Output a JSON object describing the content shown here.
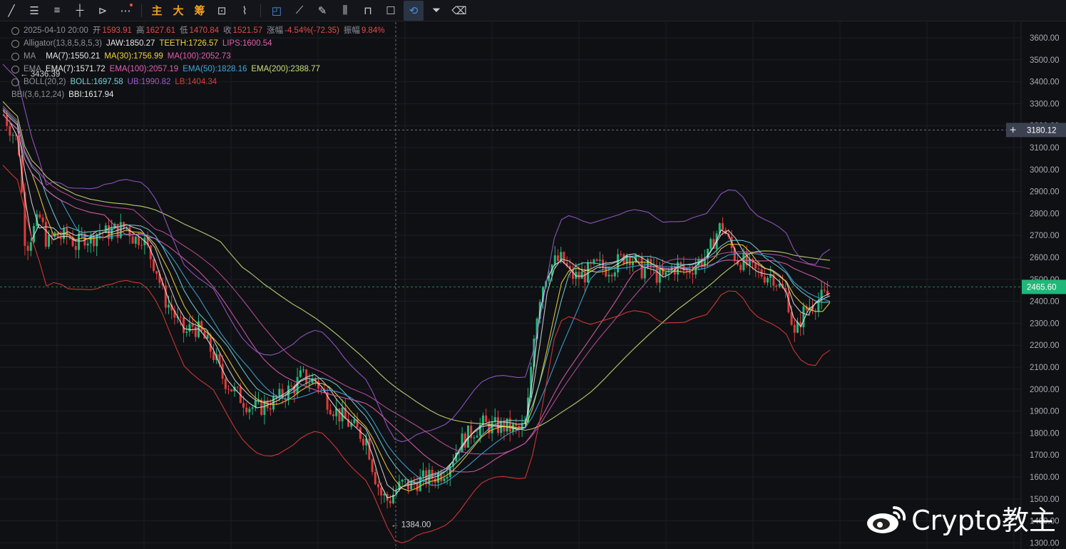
{
  "toolbar": {
    "tools": [
      {
        "name": "line-tool-icon",
        "glyph": "╱"
      },
      {
        "name": "parallel-lines-icon",
        "glyph": "☰"
      },
      {
        "name": "channel-icon",
        "glyph": "≡"
      },
      {
        "name": "horizontal-line-icon",
        "glyph": "┼"
      },
      {
        "name": "arrow-tool-icon",
        "glyph": "⊳"
      },
      {
        "name": "more-icon",
        "glyph": "⋯"
      }
    ],
    "main_label": "主",
    "big_label": "大",
    "chips_label": "筹",
    "right_tools": [
      {
        "name": "crop-icon",
        "glyph": "⊡"
      },
      {
        "name": "ruler-icon",
        "glyph": "⌇"
      },
      {
        "name": "pen-icon",
        "glyph": "✎"
      },
      {
        "name": "candles-icon",
        "glyph": "⫼"
      },
      {
        "name": "lock-icon",
        "glyph": "⊓"
      },
      {
        "name": "note-icon",
        "glyph": "☐"
      },
      {
        "name": "magnet-icon",
        "glyph": "⟲"
      },
      {
        "name": "filter-icon",
        "glyph": "⏷"
      },
      {
        "name": "trash-icon",
        "glyph": "🗑"
      }
    ]
  },
  "legend": {
    "ohlc": {
      "datetime": "2025-04-10 20:00",
      "open_label": "开",
      "open": "1593.91",
      "high_label": "高",
      "high": "1627.61",
      "low_label": "低",
      "low": "1470.84",
      "close_label": "收",
      "close": "1521.57",
      "change_label": "涨幅",
      "change": "-4.54%(-72.35)",
      "amplitude_label": "振幅",
      "amplitude": "9.84%"
    },
    "alligator": {
      "label": "Alligator(13,8,5,8,5,3)",
      "jaw": "JAW:1850.27",
      "teeth": "TEETH:1726.57",
      "lips": "LIPS:1600.54"
    },
    "ma": {
      "label": "MA",
      "ma7": "MA(7):1550.21",
      "ma30": "MA(30):1756.99",
      "ma100": "MA(100):2052.73"
    },
    "ema": {
      "label": "EMA",
      "ema7": "EMA(7):1571.72",
      "ema100": "EMA(100):2057.19",
      "ema50": "EMA(50):1828.16",
      "ema200": "EMA(200):2388.77"
    },
    "boll": {
      "label": "BOLL(20,2)",
      "boll": "BOLL:1697.58",
      "ub": "UB:1990.82",
      "lb": "LB:1404.34"
    },
    "bbi": {
      "label": "BBI(3,6,12,24)",
      "bbi": "BBI:1617.94"
    }
  },
  "price_axis": {
    "ticks": [
      "3600.00",
      "3500.00",
      "3400.00",
      "3300.00",
      "3200.00",
      "3100.00",
      "3000.00",
      "2900.00",
      "2800.00",
      "2700.00",
      "2600.00",
      "2500.00",
      "2400.00",
      "2300.00",
      "2200.00",
      "2100.00",
      "2000.00",
      "1900.00",
      "1800.00",
      "1700.00",
      "1600.00",
      "1500.00",
      "1400.00",
      "1300.00"
    ],
    "crosshair_price": "3180.12",
    "crosshair_plus": "+",
    "last_price": "2465.60"
  },
  "annotations": {
    "high_marker": "3436.39",
    "low_marker": "1384.00"
  },
  "chart_data": {
    "type": "candlestick",
    "price_range": [
      1300,
      3650
    ],
    "path_points": [
      3250,
      3180,
      3120,
      2640,
      2720,
      2780,
      2660,
      2700,
      2690,
      2700,
      2650,
      2700,
      2680,
      2720,
      2710,
      2720,
      2730,
      2740,
      2680,
      2700,
      2620,
      2550,
      2420,
      2370,
      2300,
      2250,
      2290,
      2260,
      2210,
      2150,
      2060,
      2020,
      1980,
      1950,
      1920,
      1910,
      1930,
      1940,
      1960,
      1990,
      2010,
      2060,
      2040,
      2040,
      1980,
      1930,
      1890,
      1860,
      1830,
      1800,
      1770,
      1620,
      1520,
      1490,
      1540,
      1570,
      1560,
      1580,
      1590,
      1600,
      1610,
      1640,
      1700,
      1760,
      1790,
      1820,
      1840,
      1830,
      1830,
      1830,
      1820,
      1810,
      1840,
      2250,
      2450,
      2550,
      2580,
      2590,
      2520,
      2510,
      2520,
      2550,
      2560,
      2550,
      2560,
      2590,
      2620,
      2580,
      2540,
      2560,
      2520,
      2500,
      2550,
      2560,
      2530,
      2560,
      2590,
      2600,
      2700,
      2750,
      2660,
      2590,
      2580,
      2540,
      2530,
      2520,
      2520,
      2460,
      2420,
      2230,
      2340,
      2380,
      2400,
      2420,
      2430
    ],
    "colors": {
      "up": "#1fb87a",
      "down": "#e03a3a",
      "grid": "#1c1e24",
      "bg": "#0f1013",
      "axis_text": "#a9abb2"
    }
  },
  "watermark": {
    "text": "Crypto教主"
  }
}
